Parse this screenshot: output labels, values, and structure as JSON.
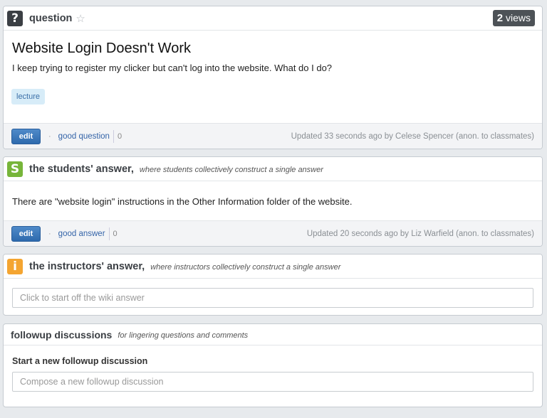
{
  "question": {
    "header": {
      "label": "question",
      "views_count": "2",
      "views_label": "views"
    },
    "title": "Website Login Doesn't Work",
    "body": "I keep trying to register my clicker but can't log into the website. What do I do?",
    "tag": "lecture",
    "footer": {
      "edit": "edit",
      "good_label": "good question",
      "good_count": "0",
      "updated": "Updated 33 seconds ago by Celese Spencer (anon. to classmates)"
    }
  },
  "students_answer": {
    "badge": "S",
    "title": "the students' answer,",
    "subtitle": "where students collectively construct a single answer",
    "body": "There are \"website login\" instructions in the Other Information folder of the website.",
    "footer": {
      "edit": "edit",
      "good_label": "good answer",
      "good_count": "0",
      "updated": "Updated 20 seconds ago by Liz Warfield (anon. to classmates)"
    }
  },
  "instructors_answer": {
    "badge": "i",
    "title": "the instructors' answer,",
    "subtitle": "where instructors collectively construct a single answer",
    "placeholder": "Click to start off the wiki answer"
  },
  "followup": {
    "title": "followup discussions",
    "subtitle": "for lingering questions and comments",
    "new_label": "Start a new followup discussion",
    "placeholder": "Compose a new followup discussion"
  },
  "colors": {
    "accent": "#2e6aad",
    "students_badge": "#77b53a",
    "instructors_badge": "#f4a531",
    "question_badge": "#3b3f44"
  },
  "icons": {
    "question": "question-mark-icon",
    "favorite": "star-icon"
  }
}
